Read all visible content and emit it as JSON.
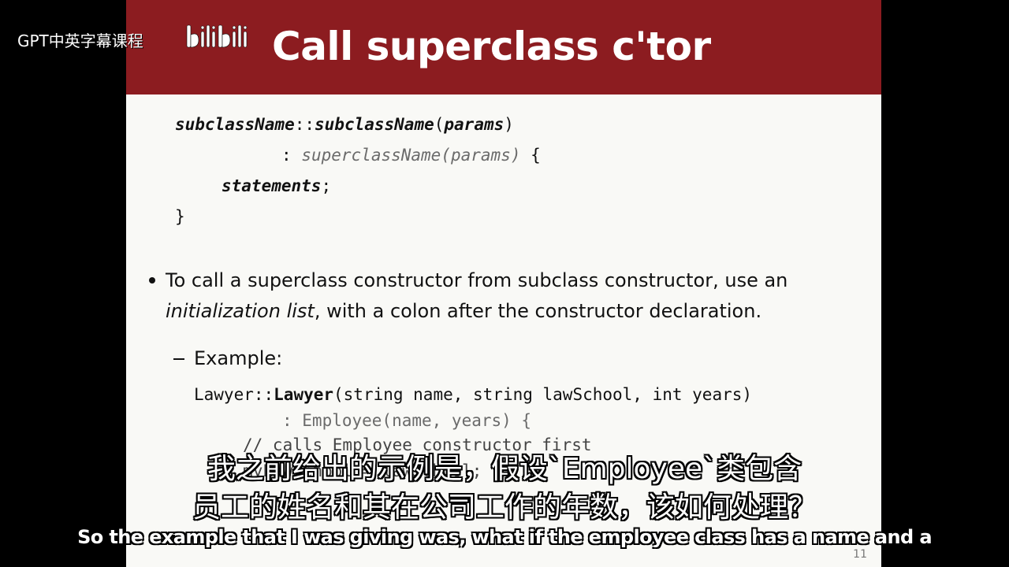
{
  "watermark": {
    "text": "GPT中英字幕课程",
    "logo": "bilibili"
  },
  "slide": {
    "title": "Call superclass c'tor",
    "syntax": {
      "line1": {
        "name_a": "subclassName",
        "sep": "::",
        "name_b": "subclassName",
        "open": "(",
        "params": "params",
        "close": ")"
      },
      "line2": {
        "colon": ":",
        "super": "superclassName",
        "open": "(",
        "params": "params",
        "close": ")",
        "brace": "{"
      },
      "line3": {
        "stmt": "statements",
        "semi": ";"
      },
      "line4": "}"
    },
    "bullet": {
      "line1": "To call a superclass constructor from subclass constructor, use an",
      "line2_italic": "initialization list",
      "line2_rest": ", with a colon after the constructor declaration."
    },
    "example_label": "Example:",
    "example": {
      "line1_a": "Lawyer::",
      "line1_b": "Lawyer",
      "line1_c": "(string name, string lawSchool, int years)",
      "line2": ": Employee(name, years) {",
      "line3": "// calls Employee constructor first",
      "line4": "myLawSchool = lawSchool;"
    },
    "page_number": "11"
  },
  "subtitles": {
    "cn_line1": "我之前给出的示例是，假设`Employee`类包含",
    "cn_line2": "员工的姓名和其在公司工作的年数，该如何处理？",
    "en": "So the example that I was giving was, what if the employee class has a name and a"
  },
  "colors": {
    "title_bar": "#8c1c20",
    "slide_bg": "#f9f9f6",
    "gray_code": "#6b6b6b"
  }
}
